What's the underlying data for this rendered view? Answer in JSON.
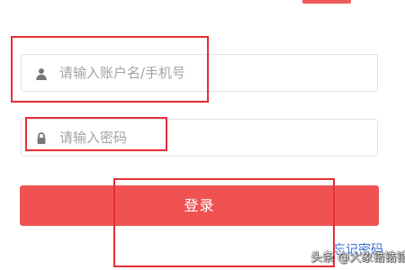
{
  "login_form": {
    "account_placeholder": "请输入账户名/手机号",
    "password_placeholder": "请输入密码",
    "login_label": "登录",
    "forgot_password_label": "忘记密码"
  },
  "watermark": {
    "text": "头条 @大象锆锆锆"
  },
  "icons": {
    "account": "user-icon",
    "password": "lock-icon"
  },
  "colors": {
    "primary": "#f05252",
    "link": "#3d73d6",
    "annotation": "#e42f36",
    "placeholder": "#a3a3a3"
  }
}
